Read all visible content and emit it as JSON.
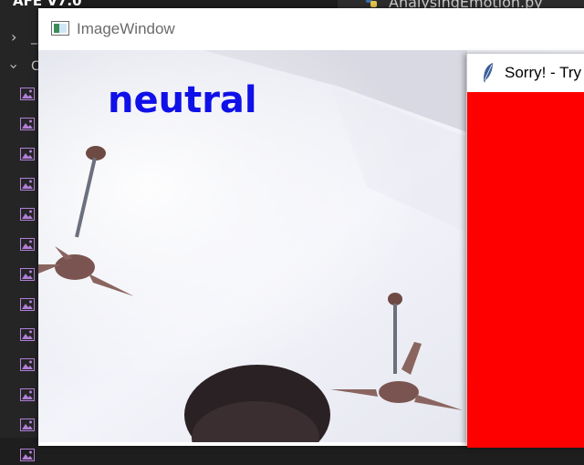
{
  "editor": {
    "explorer_title": "AFE V7.0",
    "collapsed_folder_label": "_",
    "expanded_folder_label": "C",
    "tab_label": "AnalysingEmotion.py",
    "file_icon": "image-file-icon",
    "file_count": 13
  },
  "image_window": {
    "title": "ImageWindow",
    "icon": "image-window-icon",
    "emotion_label": "neutral",
    "emotion_color": "#1010e8"
  },
  "sorry_window": {
    "title": "Sorry! - Try",
    "icon": "feather-icon",
    "body_color": "#ff0000"
  }
}
